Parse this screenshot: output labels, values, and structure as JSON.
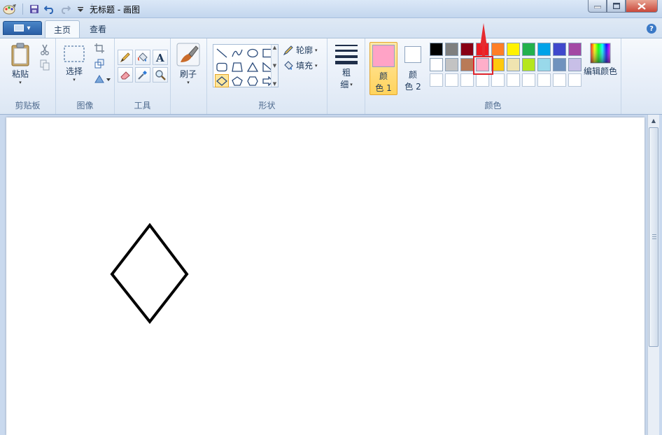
{
  "window": {
    "title": "无标题 - 画图"
  },
  "tabs": [
    {
      "label": "主页",
      "active": true
    },
    {
      "label": "查看",
      "active": false
    }
  ],
  "ribbon": {
    "clipboard": {
      "group_label": "剪贴板",
      "paste_label": "粘贴"
    },
    "image": {
      "group_label": "图像",
      "select_label": "选择"
    },
    "tools": {
      "group_label": "工具"
    },
    "brushes": {
      "label": "刷子"
    },
    "shapes": {
      "group_label": "形状",
      "outline_label": "轮廓",
      "fill_label": "填充"
    },
    "size": {
      "label_top": "粗",
      "label_bottom": "细"
    },
    "colors": {
      "group_label": "颜色",
      "color1_top": "颜",
      "color1_bottom": "色 1",
      "color2_top": "颜",
      "color2_bottom": "色 2",
      "color1_value": "#ffa3c6",
      "color2_value": "#ffffff",
      "edit_label": "编辑颜色",
      "palette_row1": [
        "#000000",
        "#7f7f7f",
        "#880015",
        "#ed1c24",
        "#ff7f27",
        "#fff200",
        "#22b14c",
        "#00a2e8",
        "#3f48cc",
        "#a349a4"
      ],
      "palette_row2": [
        "#ffffff",
        "#c3c3c3",
        "#b97a57",
        "#ffaec9",
        "#ffc90e",
        "#efe4b0",
        "#b5e61d",
        "#99d9ea",
        "#7092be",
        "#c8bfe7"
      ]
    }
  },
  "canvas": {
    "shape": "diamond",
    "stroke_color": "#000000"
  }
}
